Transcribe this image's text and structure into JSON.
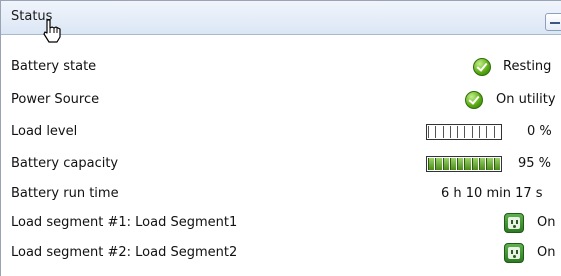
{
  "panel": {
    "title": "Status",
    "collapse_label": "−"
  },
  "rows": [
    {
      "label": "Battery state",
      "value": "Resting",
      "icon": "check-icon"
    },
    {
      "label": "Power Source",
      "value": "On utility",
      "icon": "check-icon"
    },
    {
      "label": "Load level",
      "value": "0 %",
      "level": 0.0
    },
    {
      "label": "Battery capacity",
      "value": "95 %",
      "level": 0.95
    },
    {
      "label": "Battery run time",
      "value": "6 h 10 min 17 s"
    },
    {
      "label": "Load segment #1: Load Segment1",
      "value": "On",
      "icon": "outlet-icon"
    },
    {
      "label": "Load segment #2: Load Segment2",
      "value": "On",
      "icon": "outlet-icon"
    }
  ]
}
